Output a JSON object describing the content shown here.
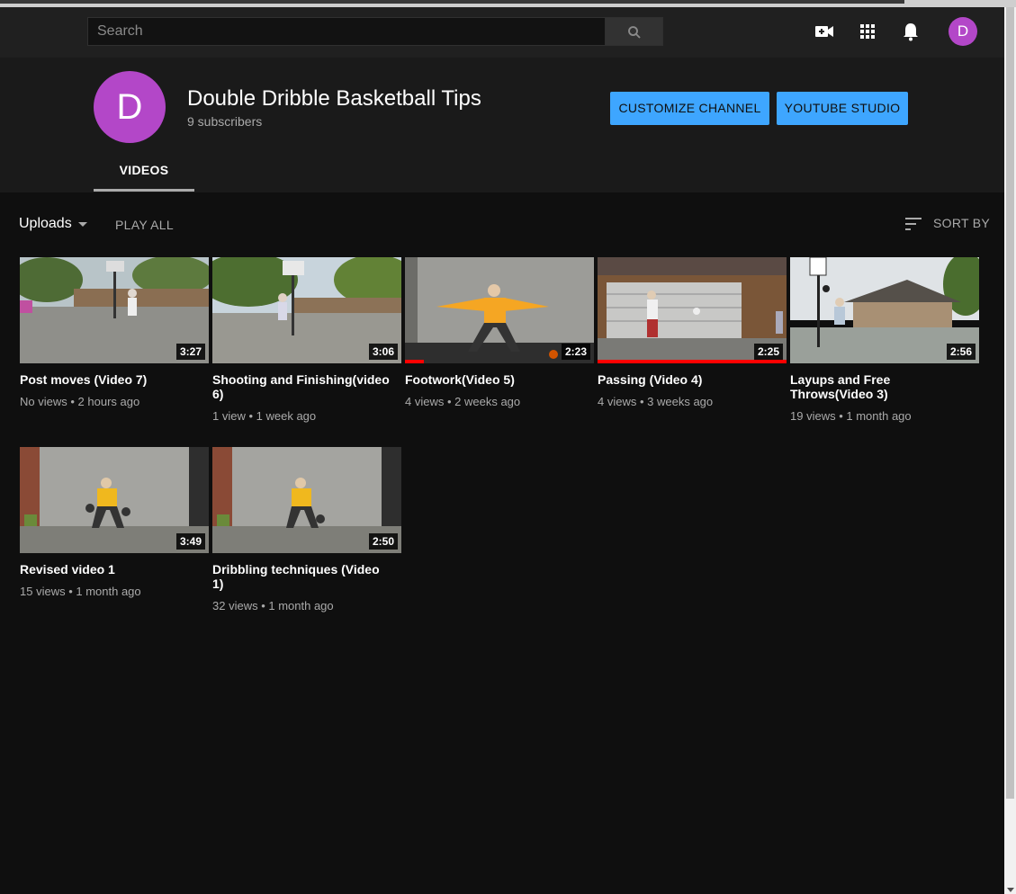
{
  "search": {
    "placeholder": "Search"
  },
  "masthead": {
    "avatar_letter": "D"
  },
  "channel": {
    "avatar_letter": "D",
    "name": "Double Dribble Basketball Tips",
    "subscribers": "9 subscribers",
    "customize_label": "CUSTOMIZE CHANNEL",
    "studio_label": "YOUTUBE STUDIO",
    "tab_videos": "VIDEOS"
  },
  "toolbar": {
    "uploads_label": "Uploads",
    "play_all_label": "PLAY ALL",
    "sort_label": "SORT BY"
  },
  "colors": {
    "accent": "#3ea6ff",
    "avatar": "#b347c8",
    "progress": "#ff0000"
  },
  "videos": [
    {
      "title": "Post moves (Video 7)",
      "views": "No views",
      "age": "2 hours ago",
      "duration": "3:27",
      "watched": 0
    },
    {
      "title": "Shooting and Finishing(video 6)",
      "views": "1 view",
      "age": "1 week ago",
      "duration": "3:06",
      "watched": 0
    },
    {
      "title": "Footwork(Video 5)",
      "views": "4 views",
      "age": "2 weeks ago",
      "duration": "2:23",
      "watched": 0.1
    },
    {
      "title": "Passing (Video 4)",
      "views": "4 views",
      "age": "3 weeks ago",
      "duration": "2:25",
      "watched": 1.0
    },
    {
      "title": "Layups and Free Throws(Video 3)",
      "views": "19 views",
      "age": "1 month ago",
      "duration": "2:56",
      "watched": 0
    },
    {
      "title": "Revised video 1",
      "views": "15 views",
      "age": "1 month ago",
      "duration": "3:49",
      "watched": 0
    },
    {
      "title": "Dribbling techniques (Video 1)",
      "views": "32 views",
      "age": "1 month ago",
      "duration": "2:50",
      "watched": 0
    }
  ]
}
